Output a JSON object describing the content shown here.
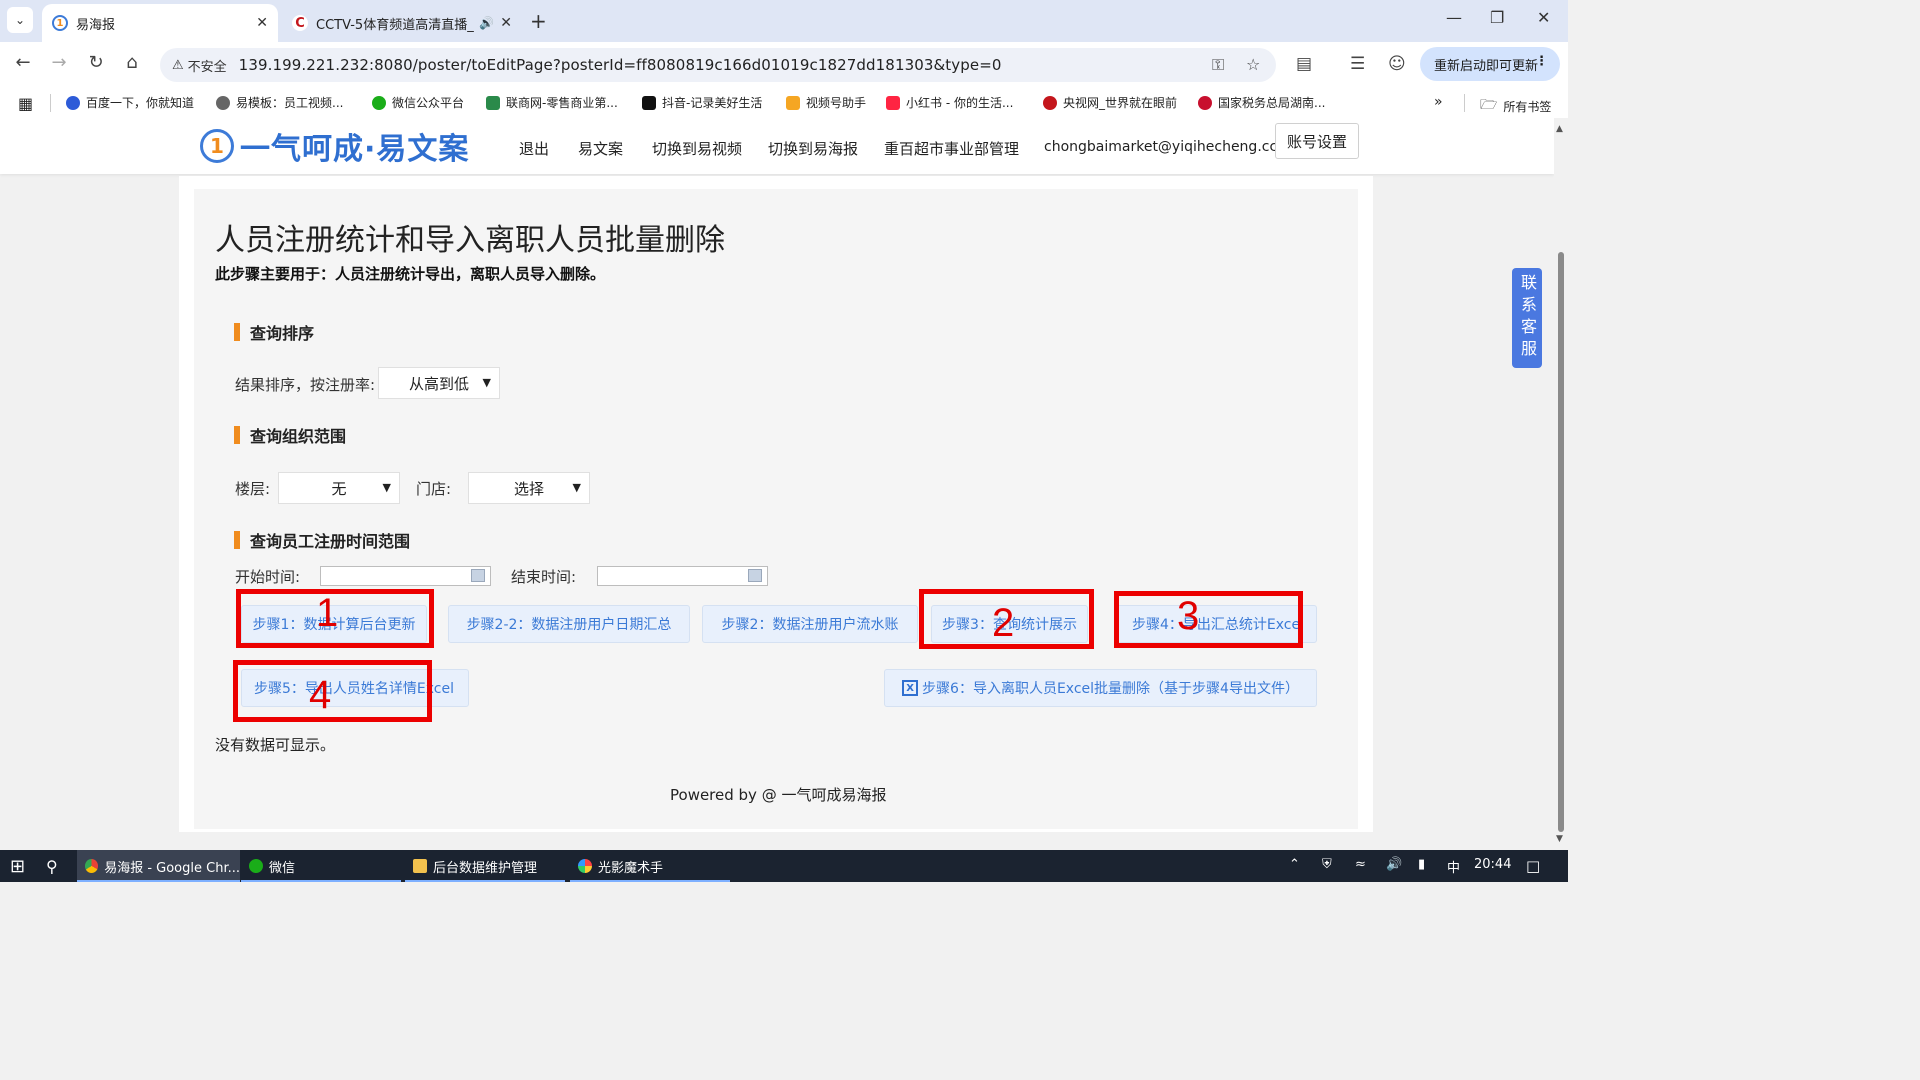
{
  "browser": {
    "tabs": [
      {
        "title": "易海报",
        "active": true
      },
      {
        "title": "CCTV-5体育频道高清直播_",
        "active": false
      }
    ],
    "url": "139.199.221.232:8080/poster/toEditPage?posterId=ff8080819c166d01019c1827dd181303&type=0",
    "security_label": "不安全",
    "update_button": "重新启动即可更新",
    "bookmarks": [
      "百度一下，你就知道",
      "易模板：员工视频...",
      "微信公众平台",
      "联商网-零售商业第...",
      "抖音-记录美好生活",
      "视频号助手",
      "小红书 - 你的生活...",
      "央视网_世界就在眼前",
      "国家税务总局湖南..."
    ],
    "all_bookmarks": "所有书签"
  },
  "site": {
    "logo_text": "一气呵成·易文案",
    "nav": [
      "退出",
      "易文案",
      "切换到易视频",
      "切换到易海报",
      "重百超市事业部管理",
      "chongbaimarket@yiqihecheng.cc"
    ],
    "account_button": "账号设置",
    "side_service": "联系客服"
  },
  "page": {
    "title": "人员注册统计和导入离职人员批量删除",
    "subtitle": "此步骤主要用于：人员注册统计导出，离职人员导入删除。",
    "section_sort": "查询排序",
    "sort_label": "结果排序，按注册率:",
    "sort_value": "从高到低",
    "section_org": "查询组织范围",
    "floor_label": "楼层:",
    "floor_value": "无",
    "store_label": "门店:",
    "store_value": "选择",
    "section_time": "查询员工注册时间范围",
    "start_label": "开始时间:",
    "end_label": "结束时间:",
    "buttons": {
      "step1": "步骤1：数据计算后台更新",
      "step2_2": "步骤2-2：数据注册用户日期汇总",
      "step2": "步骤2：数据注册用户流水账",
      "step3": "步骤3：查询统计展示",
      "step4": "步骤4：导出汇总统计Excel",
      "step5": "步骤5：导出人员姓名详情Excel",
      "step6": "步骤6：导入离职人员Excel批量删除（基于步骤4导出文件）"
    },
    "no_data": "没有数据可显示。",
    "powered_by": "Powered by @ 一气呵成易海报"
  },
  "annotations": [
    "1",
    "2",
    "3",
    "4"
  ],
  "taskbar": {
    "items": [
      "易海报 - Google Chr...",
      "微信",
      "后台数据维护管理",
      "光影魔术手"
    ],
    "ime": "中",
    "time": "20:44"
  },
  "colors": {
    "accent": "#f08c1e",
    "button_text": "#3b7ad6",
    "button_bg": "#e8f0fc",
    "annotation": "#ec0000",
    "logo_blue": "#2f6fd0"
  }
}
